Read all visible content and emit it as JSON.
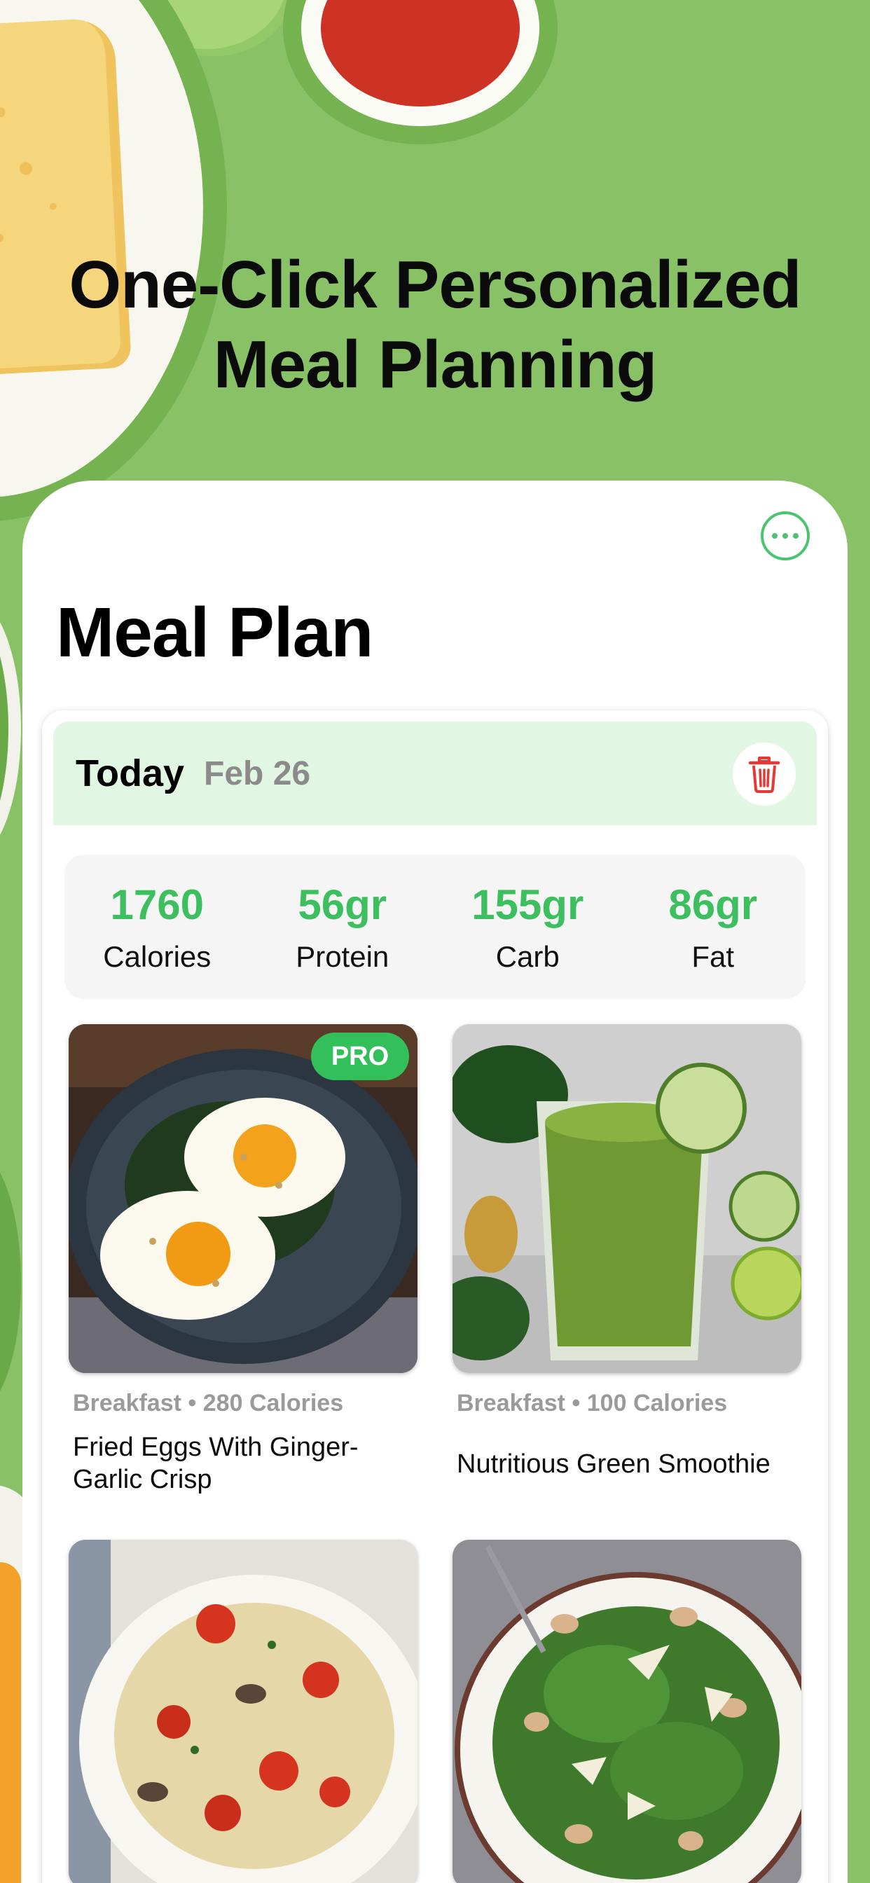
{
  "hero": {
    "title_line1": "One-Click Personalized",
    "title_line2": "Meal Planning"
  },
  "screen": {
    "title": "Meal Plan",
    "more_icon": "ellipsis-circle-icon",
    "day": {
      "label": "Today",
      "date": "Feb 26",
      "delete_icon": "trash-icon"
    },
    "macros": [
      {
        "value": "1760",
        "label": "Calories"
      },
      {
        "value": "56gr",
        "label": "Protein"
      },
      {
        "value": "155gr",
        "label": "Carb"
      },
      {
        "value": "86gr",
        "label": "Fat"
      }
    ],
    "meals": [
      {
        "meta": "Breakfast • 280 Calories",
        "name": "Fried Eggs With Ginger-Garlic Crisp",
        "badge": "PRO",
        "image": "fried-eggs-photo"
      },
      {
        "meta": "Breakfast • 100 Calories",
        "name": "Nutritious Green Smoothie",
        "image": "green-smoothie-photo"
      },
      {
        "image": "pasta-photo"
      },
      {
        "image": "salad-photo"
      }
    ]
  },
  "colors": {
    "accent": "#3dbf5f",
    "background": "#88c166",
    "header_tint": "#e1f6e3",
    "delete": "#e53935"
  }
}
